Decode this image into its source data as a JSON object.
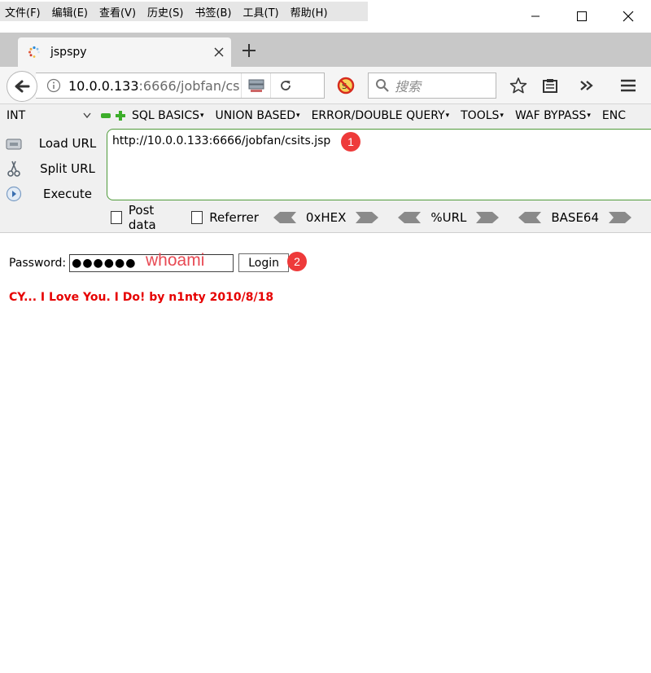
{
  "menubar": {
    "items": [
      "文件(F)",
      "编辑(E)",
      "查看(V)",
      "历史(S)",
      "书签(B)",
      "工具(T)",
      "帮助(H)"
    ]
  },
  "tab": {
    "title": "jspspy"
  },
  "navbar": {
    "url_host": "10.0.0.133",
    "url_rest": ":6666/jobfan/cs",
    "search_placeholder": "搜索"
  },
  "hackbar": {
    "select_value": "INT",
    "menu": [
      "SQL BASICS",
      "UNION BASED",
      "ERROR/DOUBLE QUERY",
      "TOOLS",
      "WAF BYPASS",
      "ENC"
    ],
    "actions": [
      "Load URL",
      "Split URL",
      "Execute"
    ],
    "url_value": "http://10.0.0.133:6666/jobfan/csits.jsp",
    "options": [
      "Post data",
      "Referrer"
    ],
    "encoders": [
      "0xHEX",
      "%URL",
      "BASE64"
    ]
  },
  "page": {
    "password_label": "Password:",
    "password_masked": "●●●●●●",
    "login_label": "Login",
    "footer": "CY... I Love You. I Do! by n1nty 2010/8/18"
  },
  "annotations": {
    "password_hint": "whoami",
    "badge1": "1",
    "badge2": "2"
  },
  "colors": {
    "hackbar_border": "#4f9a3a",
    "annotation": "#e84a54",
    "footer": "#e60000"
  }
}
